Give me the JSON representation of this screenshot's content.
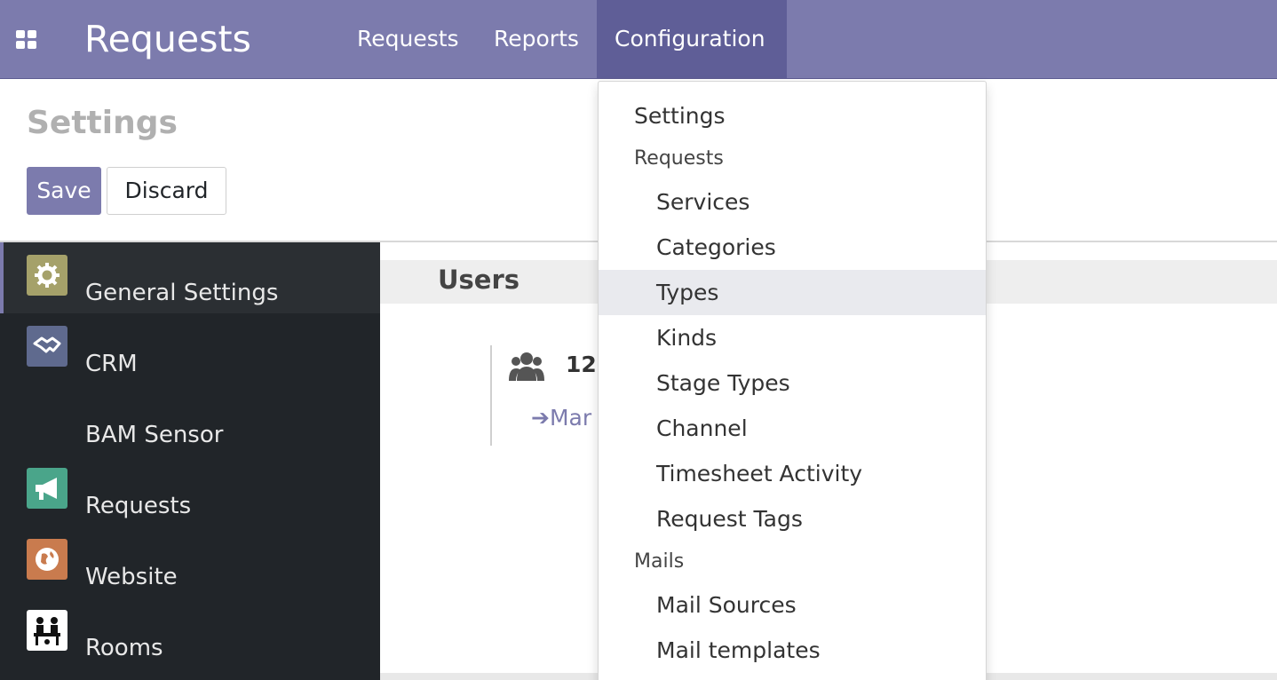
{
  "navbar": {
    "apps_icon": "apps-grid-icon",
    "brand": "Requests",
    "menu": [
      {
        "label": "Requests"
      },
      {
        "label": "Reports"
      },
      {
        "label": "Configuration",
        "active": true
      }
    ],
    "colors": {
      "bar": "#7c7bad",
      "active": "#5f5e97"
    }
  },
  "control_panel": {
    "title": "Settings",
    "save_label": "Save",
    "discard_label": "Discard"
  },
  "sidebar": {
    "items": [
      {
        "label": "General Settings",
        "icon": "gear-icon",
        "icon_color": "#a5a16a",
        "active": true
      },
      {
        "label": "CRM",
        "icon": "handshake-icon",
        "icon_color": "#5f6a8e"
      },
      {
        "label": "BAM Sensor",
        "icon": ""
      },
      {
        "label": "Requests",
        "icon": "megaphone-icon",
        "icon_color": "#4aa58a"
      },
      {
        "label": "Website",
        "icon": "globe-icon",
        "icon_color": "#c97b4e"
      },
      {
        "label": "Rooms",
        "icon": "meeting-people-icon",
        "icon_color": "#ffffff"
      }
    ]
  },
  "main": {
    "section_title": "Users",
    "users_count": "12",
    "users_icon": "users-group-icon",
    "manage_link": "Mar",
    "arrow_icon": "arrow-right-icon"
  },
  "dropdown": {
    "items": [
      {
        "label": "Settings",
        "type": "item",
        "level": 1
      },
      {
        "label": "Requests",
        "type": "header"
      },
      {
        "label": "Services",
        "type": "item",
        "level": 2
      },
      {
        "label": "Categories",
        "type": "item",
        "level": 2
      },
      {
        "label": "Types",
        "type": "item",
        "level": 2,
        "hover": true
      },
      {
        "label": "Kinds",
        "type": "item",
        "level": 2
      },
      {
        "label": "Stage Types",
        "type": "item",
        "level": 2
      },
      {
        "label": "Channel",
        "type": "item",
        "level": 2
      },
      {
        "label": "Timesheet Activity",
        "type": "item",
        "level": 2
      },
      {
        "label": "Request Tags",
        "type": "item",
        "level": 2
      },
      {
        "label": "Mails",
        "type": "header"
      },
      {
        "label": "Mail Sources",
        "type": "item",
        "level": 2
      },
      {
        "label": "Mail templates",
        "type": "item",
        "level": 2
      }
    ]
  }
}
